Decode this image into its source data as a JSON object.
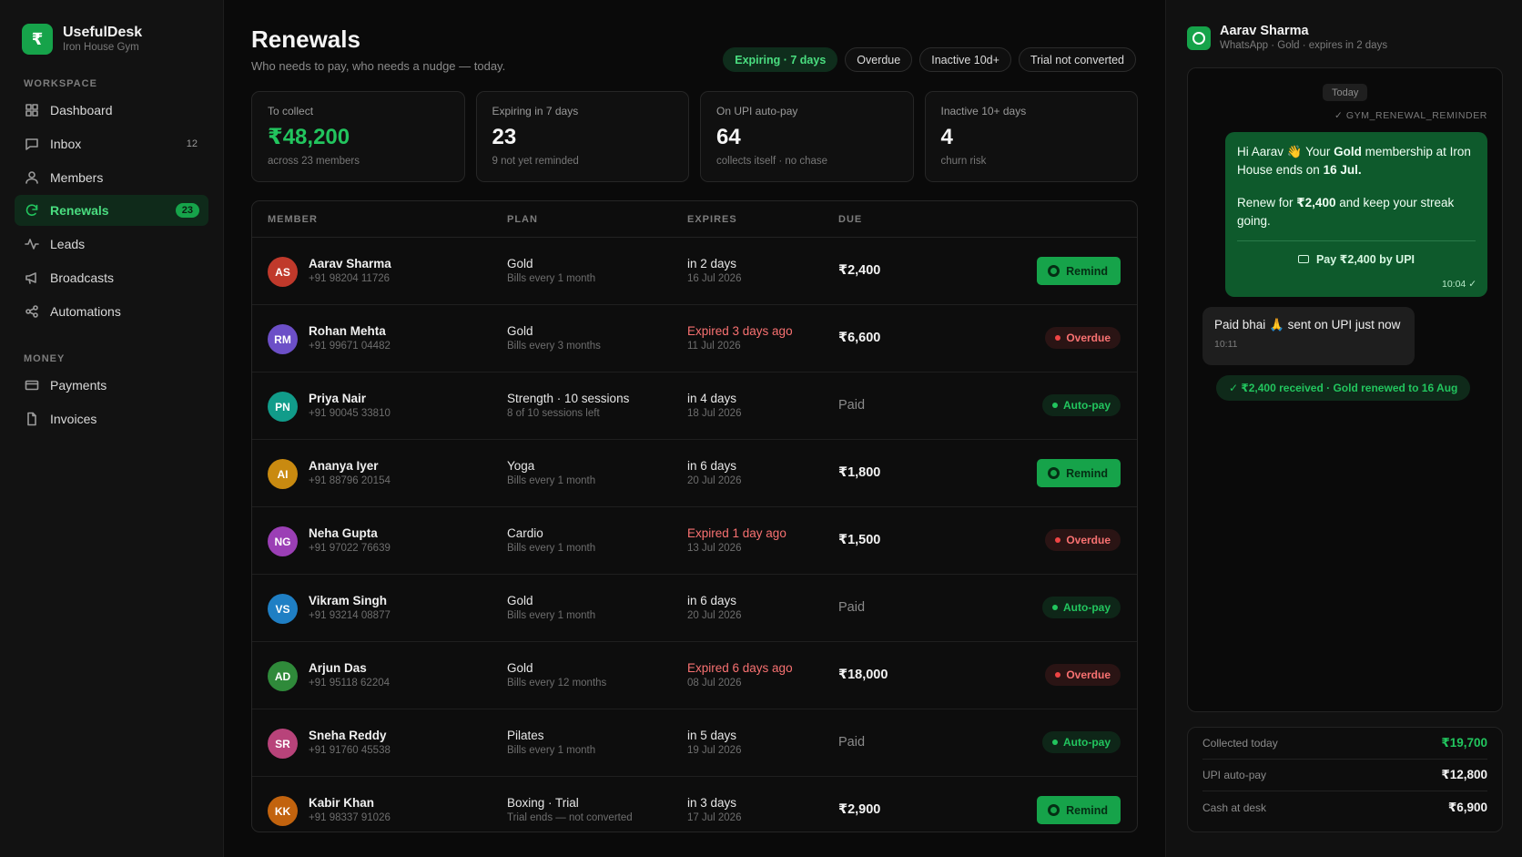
{
  "brand": {
    "logo_glyph": "₹",
    "name": "UsefulDesk",
    "sub": "Iron House Gym"
  },
  "sidebar": {
    "workspace_label": "WORKSPACE",
    "money_label": "MONEY",
    "workspace_items": [
      {
        "label": "Dashboard",
        "icon": "grid-icon",
        "count": ""
      },
      {
        "label": "Inbox",
        "icon": "chat-icon",
        "count": "12"
      },
      {
        "label": "Members",
        "icon": "user-icon",
        "count": ""
      },
      {
        "label": "Renewals",
        "icon": "refresh-icon",
        "count": "23",
        "active": true
      },
      {
        "label": "Leads",
        "icon": "pulse-icon",
        "count": ""
      },
      {
        "label": "Broadcasts",
        "icon": "megaphone-icon",
        "count": ""
      },
      {
        "label": "Automations",
        "icon": "share-icon",
        "count": ""
      }
    ],
    "money_items": [
      {
        "label": "Payments",
        "icon": "card-icon"
      },
      {
        "label": "Invoices",
        "icon": "file-icon"
      }
    ]
  },
  "header": {
    "title": "Renewals",
    "subtitle": "Who needs to pay, who needs a nudge — today.",
    "filters": [
      "Expiring · 7 days",
      "Overdue",
      "Inactive 10d+",
      "Trial not converted"
    ],
    "active_filter": 0
  },
  "stats": [
    {
      "label": "To collect",
      "value": "₹48,200",
      "note": "across 23 members",
      "green": true
    },
    {
      "label": "Expiring in 7 days",
      "value": "23",
      "note": "9 not yet reminded"
    },
    {
      "label": "On UPI auto-pay",
      "value": "64",
      "note": "collects itself · no chase"
    },
    {
      "label": "Inactive 10+ days",
      "value": "4",
      "note": "churn risk"
    }
  ],
  "table": {
    "columns": [
      "MEMBER",
      "PLAN",
      "EXPIRES",
      "DUE"
    ],
    "rows": [
      {
        "initials": "AS",
        "color": "#c0392b",
        "name": "Aarav Sharma",
        "phone": "+91 98204 11726",
        "plan": "Gold",
        "plan_sub": "Bills every 1 month",
        "expires": "in 2 days",
        "expires_red": false,
        "date": "16 Jul 2026",
        "due": "₹2,400",
        "paid": false,
        "action": "Remind"
      },
      {
        "initials": "RM",
        "color": "#6c4fc7",
        "name": "Rohan Mehta",
        "phone": "+91 99671 04482",
        "plan": "Gold",
        "plan_sub": "Bills every 3 months",
        "expires": "Expired 3 days ago",
        "expires_red": true,
        "date": "11 Jul 2026",
        "due": "₹6,600",
        "paid": false,
        "action": "Overdue"
      },
      {
        "initials": "PN",
        "color": "#119c8a",
        "name": "Priya Nair",
        "phone": "+91 90045 33810",
        "plan": "Strength · 10 sessions",
        "plan_sub": "8 of 10 sessions left",
        "expires": "in 4 days",
        "expires_red": false,
        "date": "18 Jul 2026",
        "due": "Paid",
        "paid": true,
        "action": "Auto-pay"
      },
      {
        "initials": "AI",
        "color": "#c98a10",
        "name": "Ananya Iyer",
        "phone": "+91 88796 20154",
        "plan": "Yoga",
        "plan_sub": "Bills every 1 month",
        "expires": "in 6 days",
        "expires_red": false,
        "date": "20 Jul 2026",
        "due": "₹1,800",
        "paid": false,
        "action": "Remind"
      },
      {
        "initials": "NG",
        "color": "#9b3fb5",
        "name": "Neha Gupta",
        "phone": "+91 97022 76639",
        "plan": "Cardio",
        "plan_sub": "Bills every 1 month",
        "expires": "Expired 1 day ago",
        "expires_red": true,
        "date": "13 Jul 2026",
        "due": "₹1,500",
        "paid": false,
        "action": "Overdue"
      },
      {
        "initials": "VS",
        "color": "#1f7fc4",
        "name": "Vikram Singh",
        "phone": "+91 93214 08877",
        "plan": "Gold",
        "plan_sub": "Bills every 1 month",
        "expires": "in 6 days",
        "expires_red": false,
        "date": "20 Jul 2026",
        "due": "Paid",
        "paid": true,
        "action": "Auto-pay"
      },
      {
        "initials": "AD",
        "color": "#2f8a3a",
        "name": "Arjun Das",
        "phone": "+91 95118 62204",
        "plan": "Gold",
        "plan_sub": "Bills every 12 months",
        "expires": "Expired 6 days ago",
        "expires_red": true,
        "date": "08 Jul 2026",
        "due": "₹18,000",
        "paid": false,
        "action": "Overdue"
      },
      {
        "initials": "SR",
        "color": "#b8437a",
        "name": "Sneha Reddy",
        "phone": "+91 91760 45538",
        "plan": "Pilates",
        "plan_sub": "Bills every 1 month",
        "expires": "in 5 days",
        "expires_red": false,
        "date": "19 Jul 2026",
        "due": "Paid",
        "paid": true,
        "action": "Auto-pay"
      },
      {
        "initials": "KK",
        "color": "#c2630e",
        "name": "Kabir Khan",
        "phone": "+91 98337 91026",
        "plan": "Boxing · Trial",
        "plan_sub": "Trial ends — not converted",
        "expires": "in 3 days",
        "expires_red": false,
        "date": "17 Jul 2026",
        "due": "₹2,900",
        "paid": false,
        "action": "Remind"
      }
    ]
  },
  "chat": {
    "name": "Aarav Sharma",
    "meta": "WhatsApp · Gold · expires in 2 days",
    "day": "Today",
    "template": "GYM_RENEWAL_REMINDER",
    "out_line1_pre": "Hi Aarav 👋 Your ",
    "out_line1_bold": "Gold",
    "out_line1_mid": " membership at Iron House ends on ",
    "out_line1_date": "16 Jul.",
    "out_line2_pre": "Renew for ",
    "out_line2_amt": "₹2,400",
    "out_line2_post": " and keep your streak going.",
    "pay_label": "Pay ₹2,400 by UPI",
    "out_time": "10:04 ✓",
    "in_msg": "Paid bhai 🙏 sent on UPI just now",
    "in_time": "10:11",
    "confirm": "✓ ₹2,400 received · Gold renewed to 16 Aug"
  },
  "summary": [
    {
      "label": "Collected today",
      "value": "₹19,700",
      "green": true
    },
    {
      "label": "UPI auto-pay",
      "value": "₹12,800",
      "green": false
    },
    {
      "label": "Cash at desk",
      "value": "₹6,900",
      "green": false
    }
  ]
}
